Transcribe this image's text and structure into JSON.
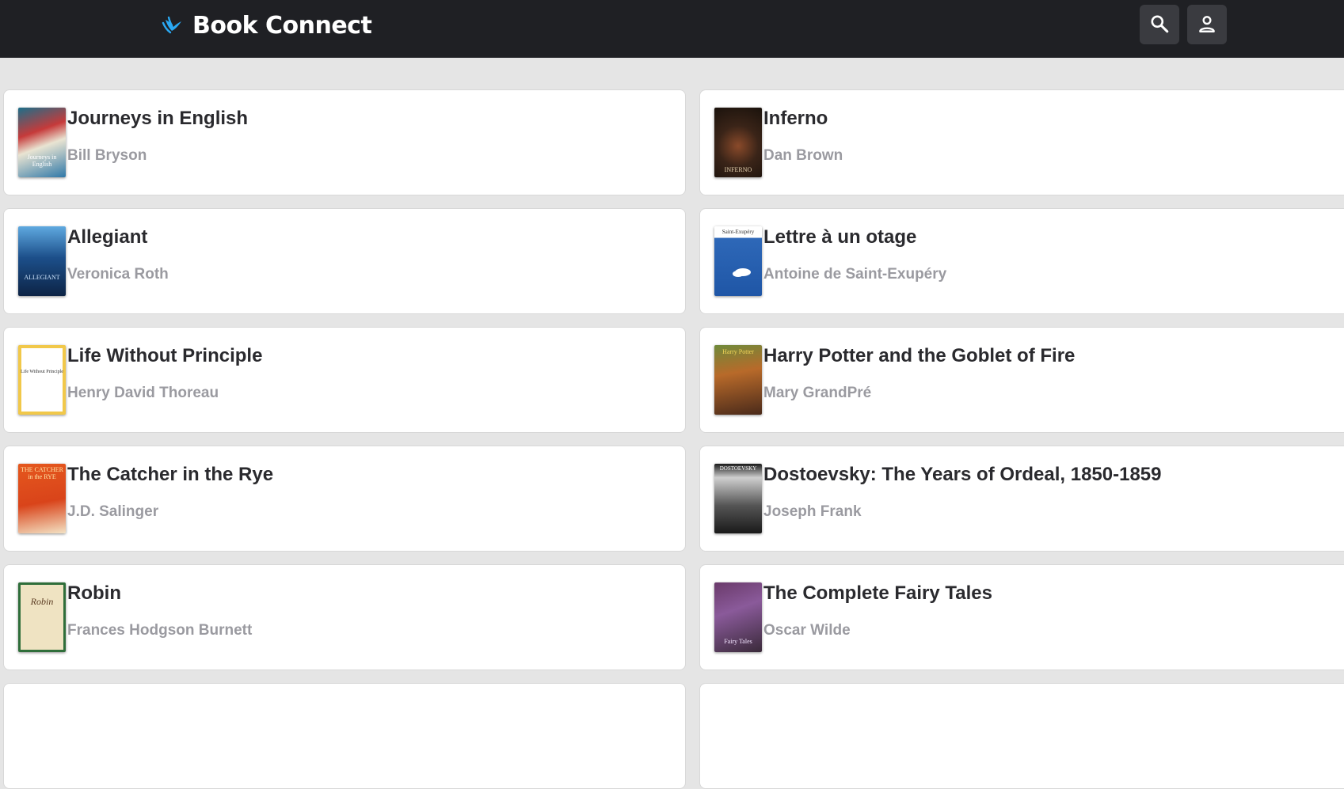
{
  "header": {
    "brand_title": "Book Connect",
    "search_icon": "search-icon",
    "account_icon": "account-icon",
    "logo_icon": "paw-logo-icon",
    "accent_color": "#2aa8f2",
    "background_color": "#1f2024"
  },
  "books": [
    {
      "title": "Journeys in English",
      "author": "Bill Bryson",
      "cover_text": "Journeys in English"
    },
    {
      "title": "Inferno",
      "author": "Dan Brown",
      "cover_text": "INFERNO"
    },
    {
      "title": "Allegiant",
      "author": "Veronica Roth",
      "cover_text": "ALLEGIANT"
    },
    {
      "title": "Lettre à un otage",
      "author": "Antoine de Saint-Exupéry",
      "cover_text": "Saint-Exupéry"
    },
    {
      "title": "Life Without Principle",
      "author": "Henry David Thoreau",
      "cover_text": "Life Without Principle"
    },
    {
      "title": "Harry Potter and the Goblet of Fire",
      "author": "Mary GrandPré",
      "cover_text": "Harry Potter"
    },
    {
      "title": "The Catcher in the Rye",
      "author": "J.D. Salinger",
      "cover_text": "THE CATCHER in the RYE"
    },
    {
      "title": "Dostoevsky: The Years of Ordeal, 1850-1859",
      "author": "Joseph Frank",
      "cover_text": "DOSTOEVSKY"
    },
    {
      "title": "Robin",
      "author": "Frances Hodgson Burnett",
      "cover_text": "Robin"
    },
    {
      "title": "The Complete Fairy Tales",
      "author": "Oscar Wilde",
      "cover_text": "Fairy Tales"
    }
  ]
}
